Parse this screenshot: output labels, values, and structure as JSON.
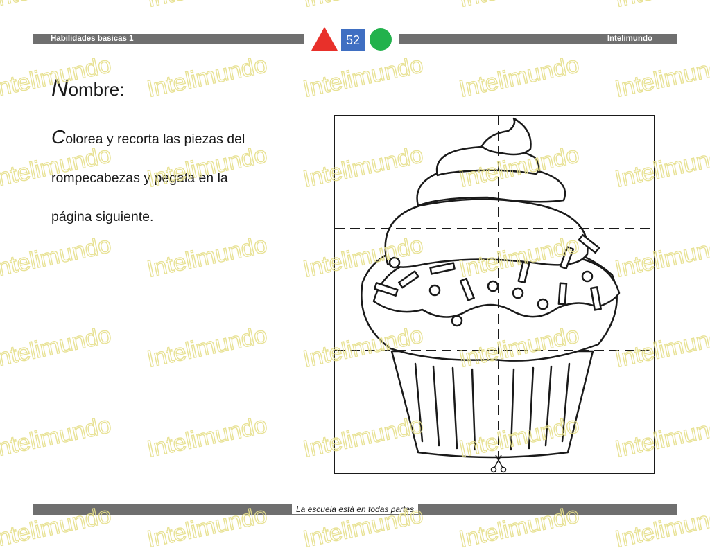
{
  "header": {
    "left_label": "Habilidades basicas 1",
    "right_label": "Intelimundo",
    "page_number": "52",
    "shape_colors": {
      "triangle": "#e8302a",
      "square": "#3f6fc2",
      "circle": "#22b24c"
    }
  },
  "form": {
    "name_initial": "N",
    "name_rest": "ombre:"
  },
  "instructions": {
    "initial": "C",
    "line1_rest": "olorea y recorta las piezas del",
    "line2": "rompecabezas y pegala en la",
    "line3": "página siguiente."
  },
  "puzzle": {
    "picture": "cupcake-outline",
    "cut_lines": "dashed",
    "columns": 2,
    "rows": 3,
    "scissors_icon": "scissors-icon"
  },
  "footer": {
    "tagline": "La escuela está en todas partes"
  },
  "watermark": {
    "text": "Intelimundo",
    "color": "#e6df8a"
  }
}
